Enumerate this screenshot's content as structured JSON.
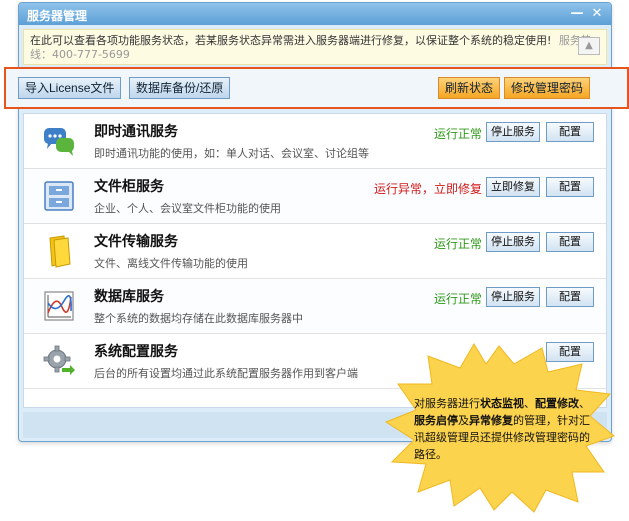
{
  "window": {
    "title": "服务器管理",
    "minimize_glyph": "—",
    "close_glyph": "✕"
  },
  "notice": {
    "text": "在此可以查看各项功能服务状态，若某服务状态异常需进入服务器端进行修复，以保证整个系统的稳定使用!",
    "hotline": "服务热线：400-777-5699",
    "collapse_glyph": "▲"
  },
  "toolbar": {
    "import_label": "导入License文件",
    "backup_label": "数据库备份/还原",
    "refresh_label": "刷新状态",
    "password_label": "修改管理密码"
  },
  "services": [
    {
      "title": "即时通讯服务",
      "desc": "即时通讯功能的使用，如：单人对话、会议室、讨论组等",
      "status": "运行正常",
      "status_kind": "ok",
      "action": "停止服务",
      "config": "配置",
      "icon": "chat-icon"
    },
    {
      "title": "文件柜服务",
      "desc": "企业、个人、会议室文件柜功能的使用",
      "status": "运行异常，立即修复",
      "status_kind": "err",
      "action": "立即修复",
      "config": "配置",
      "icon": "cabinet-icon"
    },
    {
      "title": "文件传输服务",
      "desc": "文件、离线文件传输功能的使用",
      "status": "运行正常",
      "status_kind": "ok",
      "action": "停止服务",
      "config": "配置",
      "icon": "folder-icon"
    },
    {
      "title": "数据库服务",
      "desc": "整个系统的数据均存储在此数据库服务器中",
      "status": "运行正常",
      "status_kind": "ok",
      "action": "停止服务",
      "config": "配置",
      "icon": "chart-icon"
    },
    {
      "title": "系统配置服务",
      "desc": "后台的所有设置均通过此系统配置服务器作用到客户端",
      "status": "",
      "status_kind": "none",
      "action": "",
      "config": "配置",
      "icon": "gear-icon"
    }
  ],
  "callout": {
    "p1": "对服务器进行",
    "b1": "状态监视",
    "p2": "、",
    "b2": "配置修改",
    "p3": "、",
    "b3": "服务启停",
    "p4": "及",
    "b4": "异常修复",
    "p5": "的管理，针对汇讯超级管理员还提供修改管理密码的路径。"
  },
  "colors": {
    "highlight_border": "#e8541e",
    "status_ok": "#2f9a1a",
    "status_err": "#d11a1a",
    "burst_fill": "#fcd34d"
  }
}
